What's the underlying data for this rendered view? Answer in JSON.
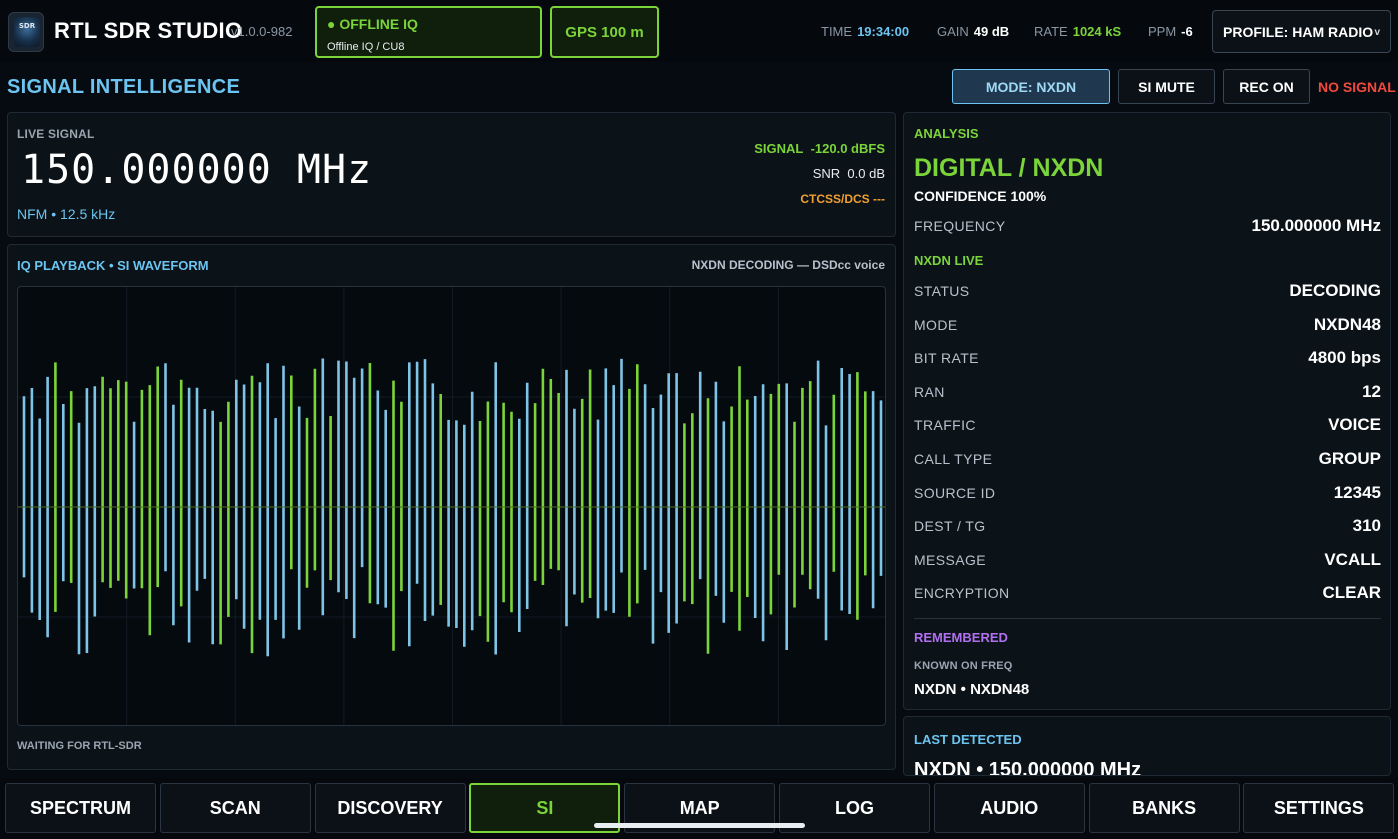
{
  "app": {
    "icon_text": "SDR",
    "title": "RTL SDR STUDIO",
    "version": "v1.0.0-982"
  },
  "source": {
    "status": "● OFFLINE IQ",
    "detail": "Offline IQ / CU8"
  },
  "gps": {
    "label": "GPS 100 m"
  },
  "stats": [
    {
      "key": "TIME",
      "value": "19:34:00",
      "color": "#6cc4f0"
    },
    {
      "key": "GAIN",
      "value": "49 dB",
      "color": "#ffffff"
    },
    {
      "key": "RATE",
      "value": "1024 kS",
      "color": "#7bd43a"
    },
    {
      "key": "PPM",
      "value": "-6",
      "color": "#ffffff"
    }
  ],
  "profile": {
    "label": "PROFILE: HAM RADIO",
    "chevron_icon": "chevron-down-icon"
  },
  "page": {
    "title": "SIGNAL INTELLIGENCE",
    "mode_button": "MODE: NXDN",
    "mute_button": "SI MUTE",
    "rec_button": "REC ON",
    "signal_status": "NO SIGNAL"
  },
  "live": {
    "label": "LIVE SIGNAL",
    "frequency": "150.000000 MHz",
    "mode_line": "NFM  •  12.5 kHz",
    "signal_label": "SIGNAL",
    "signal_value": "-120.0 dBFS",
    "snr_label": "SNR",
    "snr_value": "0.0 dB",
    "ctcss": "CTCSS/DCS ---"
  },
  "waveform": {
    "title": "IQ PLAYBACK • SI WAVEFORM",
    "decoder": "NXDN DECODING — DSDcc voice",
    "footer": "WAITING FOR RTL-SDR"
  },
  "analysis": {
    "heading": "ANALYSIS",
    "classification": "DIGITAL / NXDN",
    "confidence": "CONFIDENCE  100%",
    "frequency_label": "FREQUENCY",
    "frequency_value": "150.000000 MHz",
    "live_heading": "NXDN LIVE",
    "rows": [
      {
        "label": "STATUS",
        "value": "DECODING"
      },
      {
        "label": "MODE",
        "value": "NXDN48"
      },
      {
        "label": "BIT RATE",
        "value": "4800 bps"
      },
      {
        "label": "RAN",
        "value": "12"
      },
      {
        "label": "TRAFFIC",
        "value": "VOICE"
      },
      {
        "label": "CALL TYPE",
        "value": "GROUP"
      },
      {
        "label": "SOURCE ID",
        "value": "12345"
      },
      {
        "label": "DEST / TG",
        "value": "310"
      },
      {
        "label": "MESSAGE",
        "value": "VCALL"
      },
      {
        "label": "ENCRYPTION",
        "value": "CLEAR"
      }
    ],
    "remembered_heading": "REMEMBERED",
    "known_label": "KNOWN ON FREQ",
    "known_value": "NXDN • NXDN48"
  },
  "last_detected": {
    "heading": "LAST DETECTED",
    "value": "NXDN  •  150.000000 MHz"
  },
  "nav": [
    {
      "label": "SPECTRUM",
      "active": false
    },
    {
      "label": "SCAN",
      "active": false
    },
    {
      "label": "DISCOVERY",
      "active": false
    },
    {
      "label": "SI",
      "active": true
    },
    {
      "label": "MAP",
      "active": false
    },
    {
      "label": "LOG",
      "active": false
    },
    {
      "label": "AUDIO",
      "active": false
    },
    {
      "label": "BANKS",
      "active": false
    },
    {
      "label": "SETTINGS",
      "active": false
    }
  ],
  "colors": {
    "accent_green": "#7bd43a",
    "accent_blue": "#6cc4f0",
    "alert_red": "#f04a3e",
    "ctcss_orange": "#f0a030",
    "remembered_purple": "#b070f0"
  }
}
